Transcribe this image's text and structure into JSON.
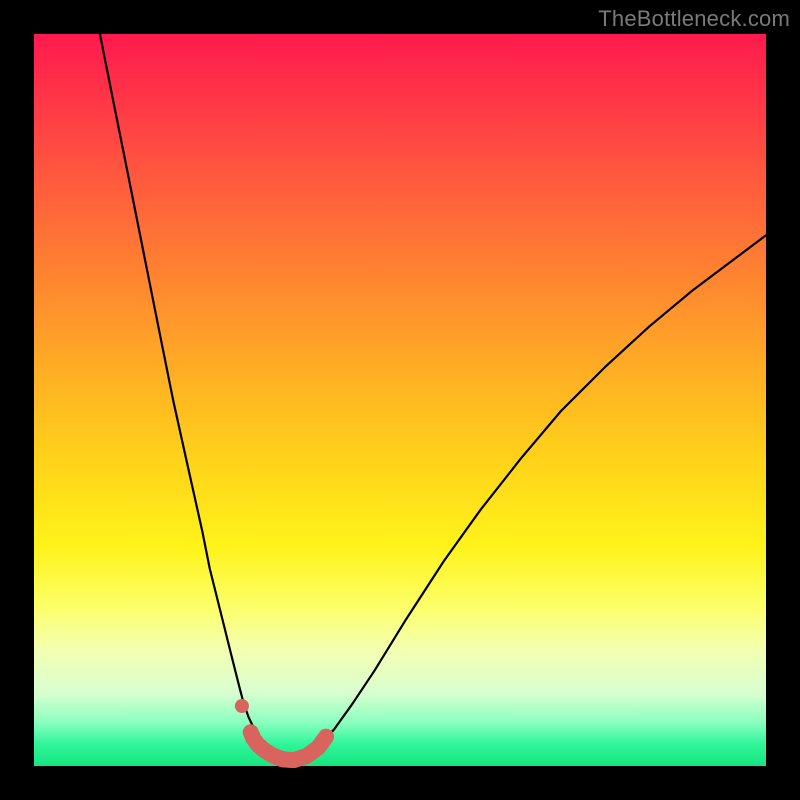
{
  "watermark": "TheBottleneck.com",
  "colors": {
    "frame": "#000000",
    "curve": "#000000",
    "marker": "#d9635d"
  },
  "chart_data": {
    "type": "line",
    "title": "",
    "xlabel": "",
    "ylabel": "",
    "xlim": [
      0,
      100
    ],
    "ylim": [
      0,
      100
    ],
    "grid": false,
    "legend": false,
    "series": [
      {
        "name": "left-curve",
        "x": [
          9,
          11,
          13,
          15,
          17,
          19,
          21,
          23,
          24,
          25,
          26,
          27,
          28,
          28.6,
          29.3,
          30.2,
          31.3,
          32.8,
          35.5
        ],
        "y": [
          100,
          90,
          80,
          70,
          60,
          50,
          41,
          32,
          27,
          23,
          19,
          15,
          11,
          8.7,
          6.7,
          4.8,
          3.1,
          1.6,
          0.6
        ]
      },
      {
        "name": "right-curve",
        "x": [
          35.5,
          37.5,
          39.4,
          41.0,
          43.5,
          46.5,
          50.8,
          56.0,
          61.0,
          66.5,
          72.0,
          78.0,
          84.0,
          90.0,
          96.0,
          100.0
        ],
        "y": [
          0.6,
          1.7,
          3.3,
          5.0,
          8.5,
          13.0,
          20.0,
          28.0,
          35.0,
          42.0,
          48.5,
          54.5,
          60.0,
          65.0,
          69.5,
          72.5
        ]
      },
      {
        "name": "highlight-band",
        "x": [
          29.6,
          30.0,
          30.6,
          31.4,
          32.5,
          34.0,
          35.5,
          37.3,
          38.8,
          39.9
        ],
        "y": [
          4.6,
          3.7,
          2.9,
          2.2,
          1.5,
          0.9,
          0.8,
          1.4,
          2.5,
          4.0
        ]
      }
    ],
    "annotations": [
      {
        "name": "dot",
        "x": 28.4,
        "y": 8.2
      }
    ],
    "gradient_stops": [
      {
        "pos": 0.0,
        "color": "#ff1a4d"
      },
      {
        "pos": 0.2,
        "color": "#ff5a3d"
      },
      {
        "pos": 0.46,
        "color": "#ffae24"
      },
      {
        "pos": 0.7,
        "color": "#fff31a"
      },
      {
        "pos": 0.9,
        "color": "#d8ffd0"
      },
      {
        "pos": 1.0,
        "color": "#16e67f"
      }
    ]
  }
}
